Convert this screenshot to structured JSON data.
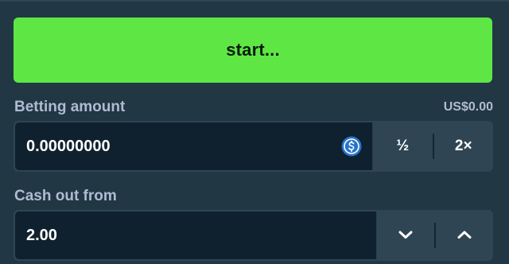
{
  "start_button": {
    "label": "start..."
  },
  "betting": {
    "label": "Betting amount",
    "usd_value": "US$0.00",
    "amount": "0.00000000",
    "currency_icon": "usdc-coin-icon",
    "half_label": "½",
    "double_label": "2×"
  },
  "cashout": {
    "label": "Cash out from",
    "value": "2.00",
    "decrease_icon": "chevron-down-icon",
    "increase_icon": "chevron-up-icon"
  },
  "colors": {
    "background": "#213743",
    "accent_green": "#5ee744",
    "input_bg": "#0f212e",
    "label_text": "#b1bad3",
    "coin_blue": "#2775ca"
  }
}
